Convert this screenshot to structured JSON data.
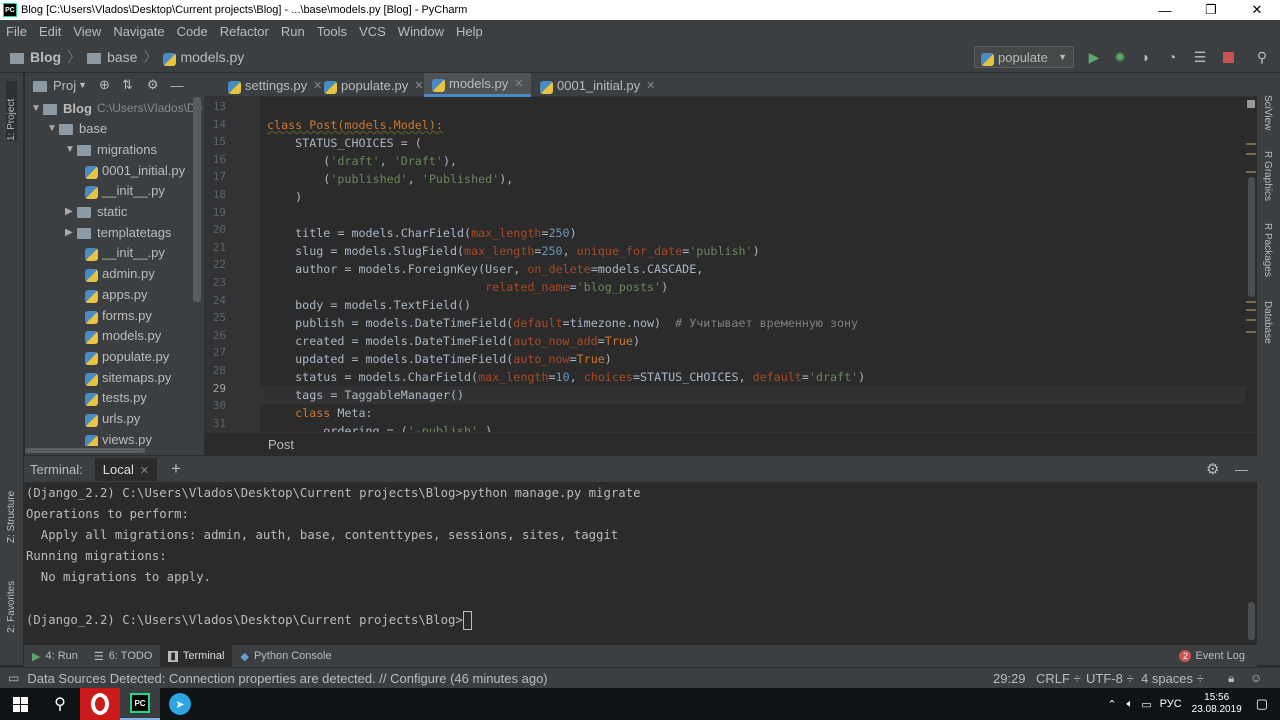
{
  "window": {
    "title": "Blog [C:\\Users\\Vlados\\Desktop\\Current projects\\Blog] - ...\\base\\models.py [Blog] - PyCharm",
    "app_icon": "PC"
  },
  "menu": [
    "File",
    "Edit",
    "View",
    "Navigate",
    "Code",
    "Refactor",
    "Run",
    "Tools",
    "VCS",
    "Window",
    "Help"
  ],
  "breadcrumb": {
    "root": "Blog",
    "folder": "base",
    "file": "models.py"
  },
  "run_config": "populate",
  "left_strip": {
    "project": "1: Project",
    "structure": "Z: Structure",
    "favorites": "2: Favorites"
  },
  "right_strip": [
    "SciView",
    "R Graphics",
    "R Packages",
    "Database"
  ],
  "project_panel": {
    "title": "Proj"
  },
  "tree": [
    {
      "label": "Blog",
      "extra": "C:\\Users\\Vlados\\De",
      "type": "folder",
      "arrow": "▼"
    },
    {
      "label": "base",
      "type": "folder",
      "arrow": "▼"
    },
    {
      "label": "migrations",
      "type": "folder",
      "arrow": "▼"
    },
    {
      "label": "0001_initial.py",
      "type": "py"
    },
    {
      "label": "__init__.py",
      "type": "py"
    },
    {
      "label": "static",
      "type": "folder",
      "arrow": "▶"
    },
    {
      "label": "templatetags",
      "type": "folder",
      "arrow": "▶"
    },
    {
      "label": "__init__.py",
      "type": "py"
    },
    {
      "label": "admin.py",
      "type": "py"
    },
    {
      "label": "apps.py",
      "type": "py"
    },
    {
      "label": "forms.py",
      "type": "py"
    },
    {
      "label": "models.py",
      "type": "py"
    },
    {
      "label": "populate.py",
      "type": "py"
    },
    {
      "label": "sitemaps.py",
      "type": "py"
    },
    {
      "label": "tests.py",
      "type": "py"
    },
    {
      "label": "urls.py",
      "type": "py"
    },
    {
      "label": "views.py",
      "type": "py"
    }
  ],
  "tabs": [
    {
      "label": "settings.py",
      "active": false
    },
    {
      "label": "populate.py",
      "active": false
    },
    {
      "label": "models.py",
      "active": true
    },
    {
      "label": "0001_initial.py",
      "active": false
    }
  ],
  "line_numbers": [
    "13",
    "14",
    "15",
    "16",
    "17",
    "18",
    "19",
    "20",
    "21",
    "22",
    "23",
    "24",
    "25",
    "26",
    "27",
    "28",
    "29",
    "30",
    "31"
  ],
  "current_line": "29",
  "code_breadcrumb": "Post",
  "terminal": {
    "title": "Terminal:",
    "tab": "Local",
    "lines": [
      "(Django_2.2) C:\\Users\\Vlados\\Desktop\\Current projects\\Blog>python manage.py migrate",
      "Operations to perform:",
      "  Apply all migrations: admin, auth, base, contenttypes, sessions, sites, taggit",
      "Running migrations:",
      "  No migrations to apply.",
      "",
      "(Django_2.2) C:\\Users\\Vlados\\Desktop\\Current projects\\Blog>"
    ]
  },
  "tool_windows": [
    {
      "label": "4: Run",
      "icon": "run-icon"
    },
    {
      "label": "6: TODO",
      "icon": "todo-icon"
    },
    {
      "label": "Terminal",
      "icon": "terminal-icon",
      "active": true
    },
    {
      "label": "Python Console",
      "icon": "python-console-icon"
    }
  ],
  "event_log": {
    "count": "2",
    "label": "Event Log"
  },
  "status": {
    "message": "Data Sources Detected: Connection properties are detected. // Configure (46 minutes ago)",
    "position": "29:29",
    "line_sep": "CRLF",
    "encoding": "UTF-8",
    "indent": "4 spaces"
  },
  "taskbar": {
    "lang": "РУС",
    "time": "15:56",
    "date": "23.08.2019"
  },
  "colors": {
    "accent": "#4a88c7",
    "keyword": "#cc7832",
    "string": "#6a8759",
    "param": "#aa4926",
    "number": "#6897bb"
  }
}
